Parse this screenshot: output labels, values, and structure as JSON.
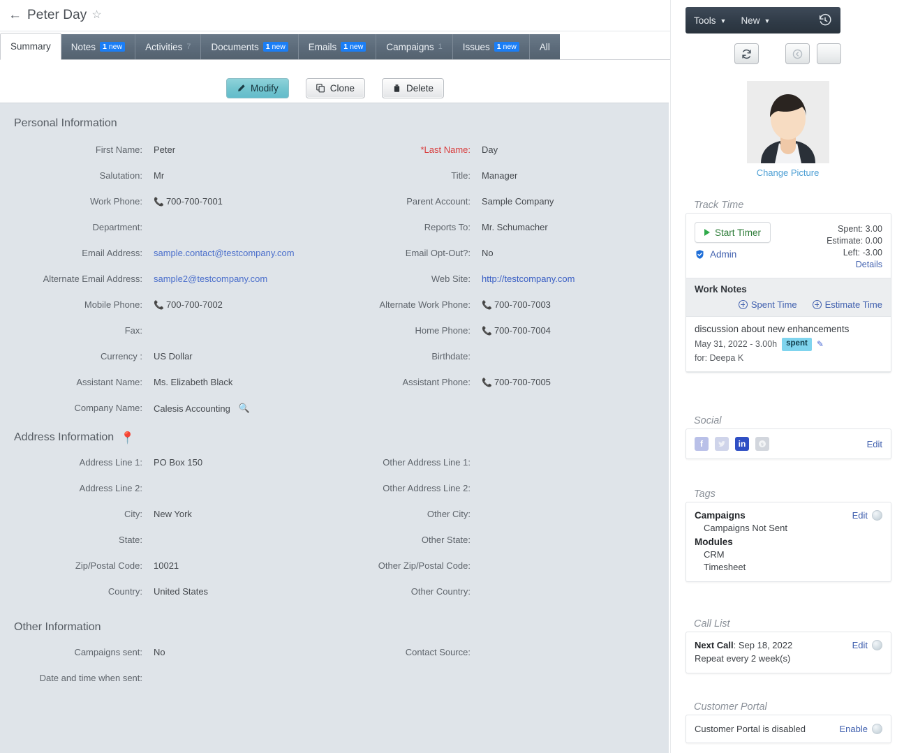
{
  "header": {
    "back_icon": "back-arrow-icon",
    "title": "Peter Day",
    "star_icon": "☆"
  },
  "tabs": [
    {
      "label": "Summary",
      "badge": "",
      "badge_type": "none",
      "active": true
    },
    {
      "label": "Notes",
      "badge": "1",
      "badge_suffix": "new",
      "badge_type": "new"
    },
    {
      "label": "Activities",
      "badge": "7",
      "badge_type": "faint"
    },
    {
      "label": "Documents",
      "badge": "1",
      "badge_suffix": "new",
      "badge_type": "new"
    },
    {
      "label": "Emails",
      "badge": "1",
      "badge_suffix": "new",
      "badge_type": "new"
    },
    {
      "label": "Campaigns",
      "badge": "1",
      "badge_type": "faint"
    },
    {
      "label": "Issues",
      "badge": "1",
      "badge_suffix": "new",
      "badge_type": "new"
    },
    {
      "label": "All",
      "badge": "",
      "badge_type": "none"
    }
  ],
  "actions": {
    "modify": "Modify",
    "clone": "Clone",
    "delete": "Delete"
  },
  "sections": {
    "personal": {
      "title": "Personal Information",
      "left": [
        {
          "label": "First Name:",
          "value": "Peter"
        },
        {
          "label": "Salutation:",
          "value": "Mr"
        },
        {
          "label": "Work Phone:",
          "value": "700-700-7001",
          "icon": "phone-icon"
        },
        {
          "label": "Department:",
          "value": ""
        },
        {
          "label": "Email Address:",
          "value": "sample.contact@testcompany.com",
          "style": "link"
        },
        {
          "label": "Alternate Email Address:",
          "value": "sample2@testcompany.com",
          "style": "link"
        },
        {
          "label": "Mobile Phone:",
          "value": "700-700-7002",
          "icon": "phone-icon"
        },
        {
          "label": "Fax:",
          "value": ""
        },
        {
          "label": "Currency :",
          "value": "US Dollar"
        },
        {
          "label": "Assistant Name:",
          "value": "Ms. Elizabeth Black"
        },
        {
          "label": "Company Name:",
          "value": "Calesis Accounting",
          "trail_icon": "lookup-search-icon"
        }
      ],
      "right": [
        {
          "label": "*Last Name:",
          "value": "Day",
          "required": true
        },
        {
          "label": "Title:",
          "value": "Manager"
        },
        {
          "label": "Parent Account:",
          "value": "Sample Company"
        },
        {
          "label": "Reports To:",
          "value": "Mr. Schumacher"
        },
        {
          "label": "Email Opt-Out?:",
          "value": "No"
        },
        {
          "label": "Web Site:",
          "value": "http://testcompany.com",
          "style": "link"
        },
        {
          "label": "Alternate Work Phone:",
          "value": "700-700-7003",
          "icon": "phone-icon"
        },
        {
          "label": "Home Phone:",
          "value": "700-700-7004",
          "icon": "phone-icon"
        },
        {
          "label": "Birthdate:",
          "value": ""
        },
        {
          "label": "",
          "value": ""
        },
        {
          "label": "Assistant Phone:",
          "value": "700-700-7005",
          "icon": "phone-icon"
        }
      ]
    },
    "address": {
      "title": "Address Information",
      "icon": "map-pin-icon",
      "left": [
        {
          "label": "Address Line 1:",
          "value": "PO Box 150"
        },
        {
          "label": "Address Line 2:",
          "value": ""
        },
        {
          "label": "City:",
          "value": "New York"
        },
        {
          "label": "State:",
          "value": ""
        },
        {
          "label": "Zip/Postal Code:",
          "value": "10021"
        },
        {
          "label": "Country:",
          "value": "United States"
        }
      ],
      "right": [
        {
          "label": "Other Address Line 1:",
          "value": ""
        },
        {
          "label": "Other Address Line 2:",
          "value": ""
        },
        {
          "label": "Other City:",
          "value": ""
        },
        {
          "label": "Other State:",
          "value": ""
        },
        {
          "label": "Other Zip/Postal Code:",
          "value": ""
        },
        {
          "label": "Other Country:",
          "value": ""
        }
      ]
    },
    "other": {
      "title": "Other Information",
      "left": [
        {
          "label": "Campaigns sent:",
          "value": "No"
        },
        {
          "label": "Date and time when sent:",
          "value": ""
        }
      ],
      "right": [
        {
          "label": "Contact Source:",
          "value": ""
        },
        {
          "label": "",
          "value": ""
        }
      ]
    }
  },
  "sidebar": {
    "toolbar": {
      "tools": "Tools",
      "new": "New",
      "caret": "▼",
      "history_icon": "history-clock-icon"
    },
    "circle_buttons": [
      {
        "name": "refresh-button",
        "icon": "refresh-icon"
      },
      {
        "name": "previous-record-button",
        "icon": "arrow-left-circle-icon"
      },
      {
        "name": "next-record-button",
        "icon": "arrow-right-circle-icon"
      }
    ],
    "avatar": {
      "name": "contact-avatar",
      "change_picture": "Change Picture"
    },
    "track_time": {
      "title": "Track Time",
      "start_timer": "Start Timer",
      "admin": "Admin",
      "spent": "Spent: 3.00",
      "estimate": "Estimate: 0.00",
      "left": "Left: -3.00",
      "details": "Details",
      "work_notes": {
        "title": "Work Notes",
        "spent_time": "Spent Time",
        "estimate_time": "Estimate Time"
      },
      "notes": [
        {
          "title": "discussion about new enhancements",
          "meta": "May 31, 2022 - 3.00h",
          "chip": "spent",
          "for": "for: Deepa K"
        }
      ]
    },
    "social": {
      "title": "Social",
      "edit": "Edit",
      "icons": [
        {
          "name": "facebook-icon",
          "glyph": "f"
        },
        {
          "name": "twitter-icon",
          "glyph": "t"
        },
        {
          "name": "linkedin-icon",
          "glyph": "in"
        },
        {
          "name": "skype-icon",
          "glyph": "s"
        }
      ]
    },
    "tags": {
      "title": "Tags",
      "edit": "Edit",
      "groups": [
        {
          "name": "Campaigns",
          "items": [
            "Campaigns Not Sent"
          ]
        },
        {
          "name": "Modules",
          "items": [
            "CRM",
            "Timesheet"
          ]
        }
      ]
    },
    "call_list": {
      "title": "Call List",
      "edit": "Edit",
      "next_call_label": "Next Call",
      "next_call_value": ": Sep 18, 2022",
      "repeat": "Repeat every 2 week(s)"
    },
    "customer_portal": {
      "title": "Customer Portal",
      "status": "Customer Portal is disabled",
      "enable": "Enable"
    }
  }
}
